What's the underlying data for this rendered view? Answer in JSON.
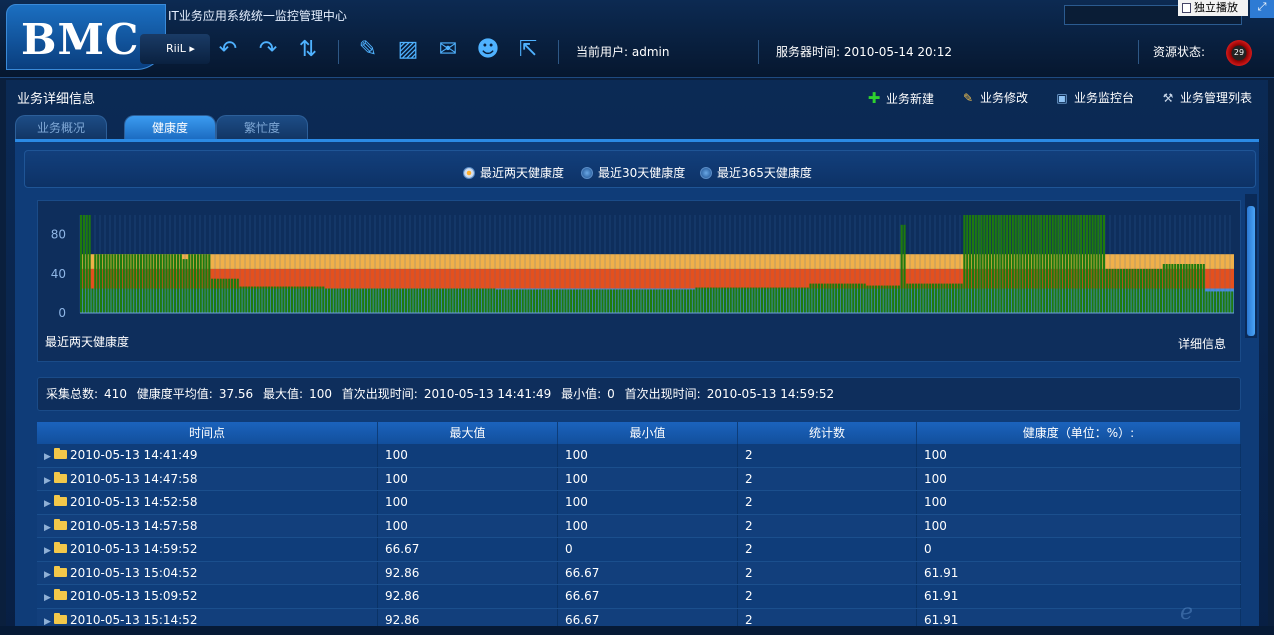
{
  "app": {
    "logo": "BMC",
    "title": "IT业务应用系统统一监控管理中心",
    "riil": "RiiL ▸",
    "current_user": "当前用户: admin",
    "server_time": "服务器时间: 2010-05-14 20:12",
    "resource_status": "资源状态:",
    "resource_gauge": "29",
    "popout_label": "独立播放"
  },
  "toolbar_icons": [
    "undo-icon",
    "redo-icon",
    "refresh-icon",
    "tools-icon",
    "report-icon",
    "mail-icon",
    "users-icon",
    "exit-icon"
  ],
  "page": {
    "section_title": "业务详细信息",
    "actions": [
      {
        "label": "业务新建",
        "icon": "add-icon"
      },
      {
        "label": "业务修改",
        "icon": "edit-icon"
      },
      {
        "label": "业务监控台",
        "icon": "monitor-icon"
      },
      {
        "label": "业务管理列表",
        "icon": "wrench-icon"
      }
    ],
    "tabs": [
      "业务概况",
      "健康度",
      "繁忙度"
    ],
    "active_tab": 1,
    "radios": [
      "最近两天健康度",
      "最近30天健康度",
      "最近365天健康度"
    ],
    "selected_radio": 0,
    "chart_caption": "最近两天健康度",
    "detail_link": "详细信息"
  },
  "stats": {
    "total_label": "采集总数:",
    "total": "410",
    "avg_label": "健康度平均值:",
    "avg": "37.56",
    "max_label": "最大值:",
    "max": "100",
    "max_time_label": "首次出现时间:",
    "max_time": "2010-05-13 14:41:49",
    "min_label": "最小值:",
    "min": "0",
    "min_time_label": "首次出现时间:",
    "min_time": "2010-05-13 14:59:52"
  },
  "table": {
    "headers": [
      "时间点",
      "最大值",
      "最小值",
      "统计数",
      "健康度（单位：%）:"
    ],
    "rows": [
      [
        "2010-05-13 14:41:49",
        "100",
        "100",
        "2",
        "100"
      ],
      [
        "2010-05-13 14:47:58",
        "100",
        "100",
        "2",
        "100"
      ],
      [
        "2010-05-13 14:52:58",
        "100",
        "100",
        "2",
        "100"
      ],
      [
        "2010-05-13 14:57:58",
        "100",
        "100",
        "2",
        "100"
      ],
      [
        "2010-05-13 14:59:52",
        "66.67",
        "0",
        "2",
        "0"
      ],
      [
        "2010-05-13 15:04:52",
        "92.86",
        "66.67",
        "2",
        "61.91"
      ],
      [
        "2010-05-13 15:09:52",
        "92.86",
        "66.67",
        "2",
        "61.91"
      ],
      [
        "2010-05-13 15:14:52",
        "92.86",
        "66.67",
        "2",
        "61.91"
      ]
    ]
  },
  "chart_data": {
    "type": "bar",
    "y_ticks": [
      "0",
      "40",
      "80"
    ],
    "ylim": [
      0,
      100
    ],
    "bands": [
      {
        "from": 0,
        "to": 25,
        "color": "#4a8cd8"
      },
      {
        "from": 25,
        "to": 45,
        "color": "#e4501d"
      },
      {
        "from": 45,
        "to": 60,
        "color": "#f0b04a"
      }
    ],
    "bar_color": "#1e7a0e",
    "segments": [
      {
        "count": 4,
        "value": 100
      },
      {
        "count": 1,
        "value": 25
      },
      {
        "count": 1,
        "value": 60
      },
      {
        "count": 30,
        "value": 60
      },
      {
        "count": 2,
        "value": 55
      },
      {
        "count": 8,
        "value": 60
      },
      {
        "count": 10,
        "value": 35
      },
      {
        "count": 30,
        "value": 27
      },
      {
        "count": 60,
        "value": 25
      },
      {
        "count": 70,
        "value": 24
      },
      {
        "count": 40,
        "value": 26
      },
      {
        "count": 20,
        "value": 30
      },
      {
        "count": 12,
        "value": 28
      },
      {
        "count": 2,
        "value": 90
      },
      {
        "count": 20,
        "value": 30
      },
      {
        "count": 50,
        "value": 100
      },
      {
        "count": 20,
        "value": 45
      },
      {
        "count": 15,
        "value": 50
      },
      {
        "count": 10,
        "value": 22
      }
    ]
  }
}
